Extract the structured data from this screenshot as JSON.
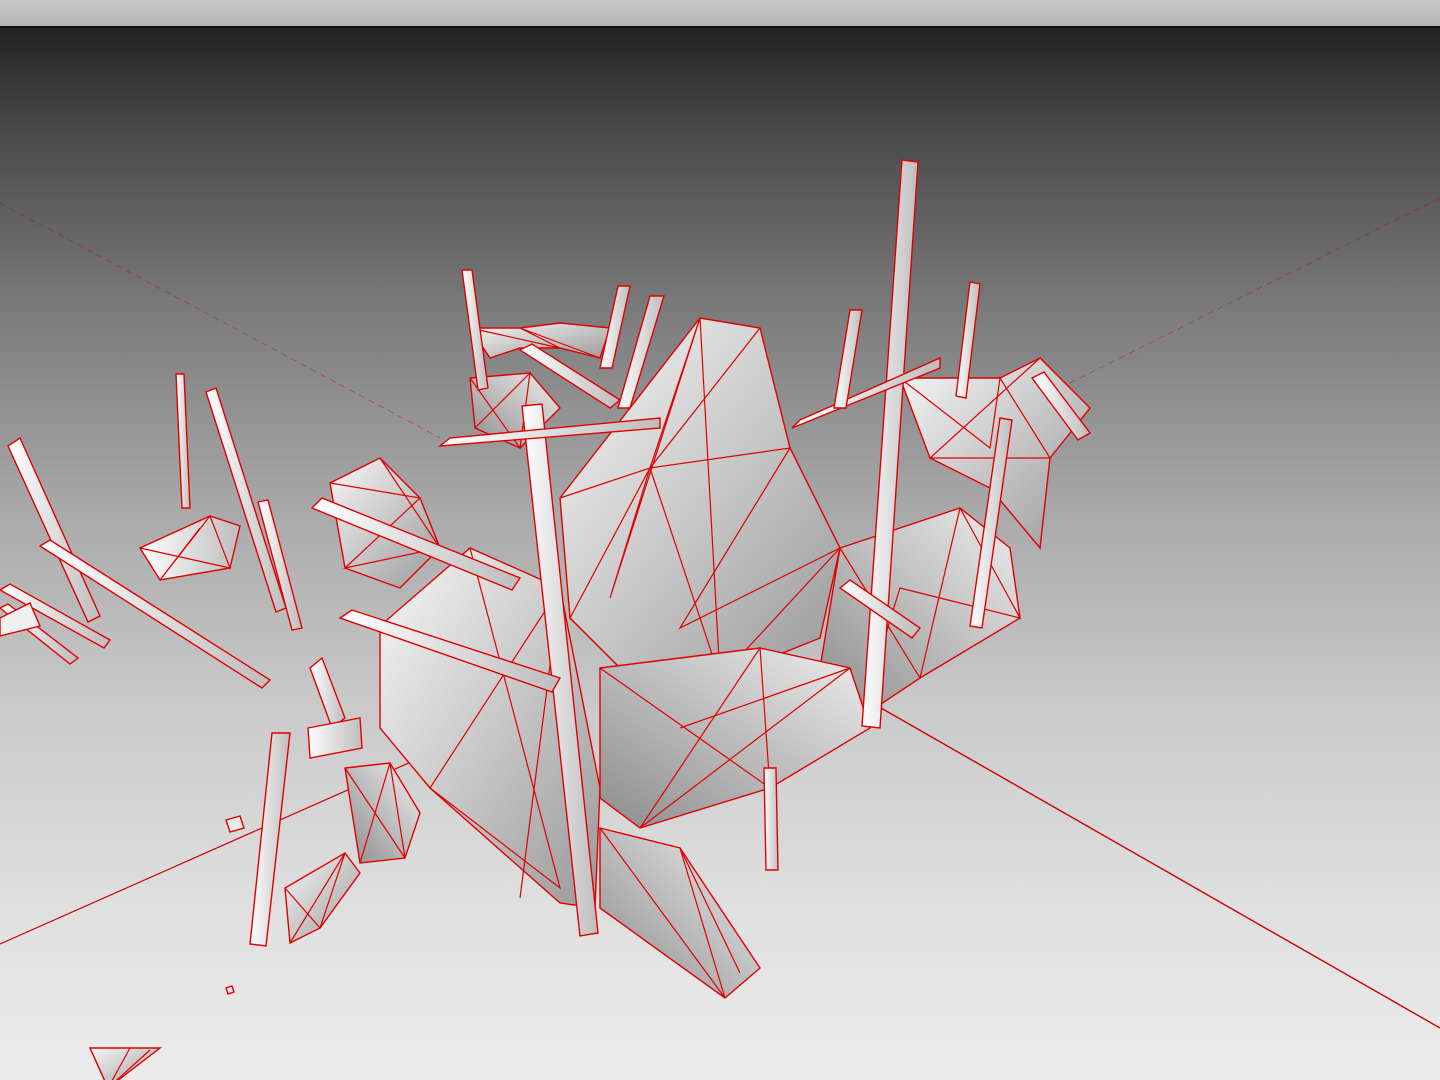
{
  "window": {
    "title": ""
  },
  "viewport": {
    "background_top": "#232323",
    "background_bottom": "#ececec",
    "mesh_face_color": "#e8e8e8",
    "wireframe_color": "#e00000",
    "axis_color": "#d00000",
    "render_mode": "shaded-with-wireframe",
    "icons": {
      "ground_axes": "axis-lines-icon",
      "model": "mesh-model-icon"
    }
  }
}
